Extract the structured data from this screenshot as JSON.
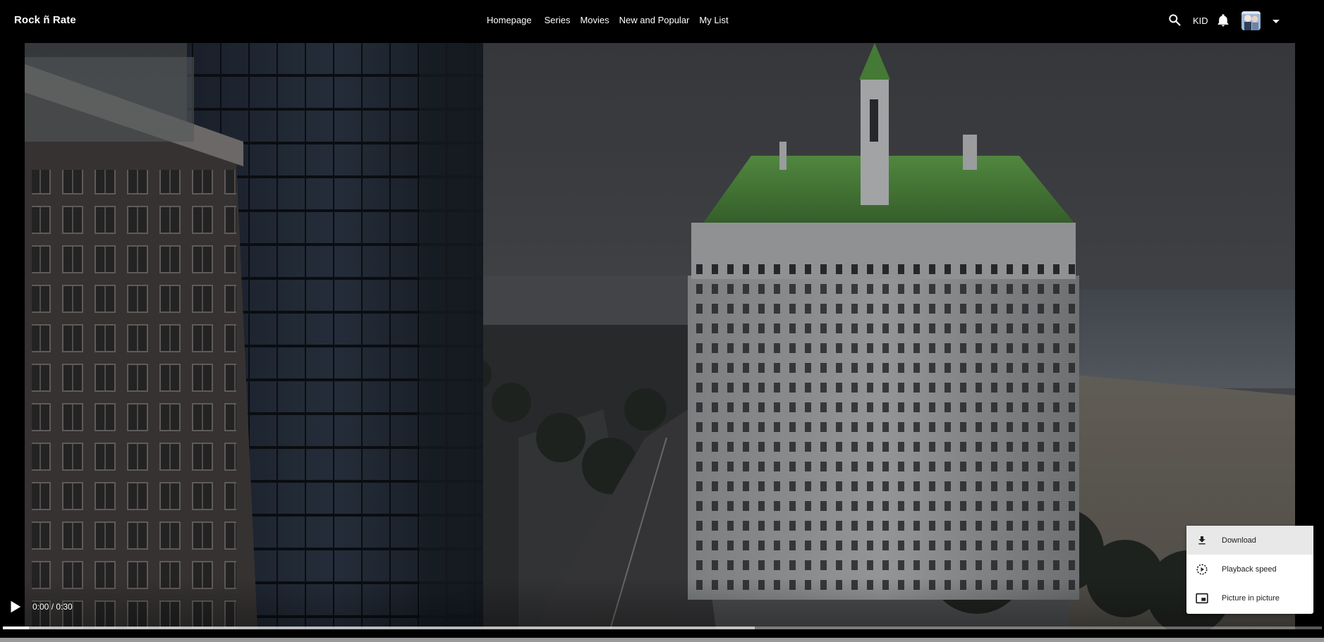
{
  "app": {
    "brand": "Rock ñ Rate"
  },
  "nav": {
    "items": [
      {
        "label": "Homepage"
      },
      {
        "label": "Series"
      },
      {
        "label": "Movies"
      },
      {
        "label": "New and Popular"
      },
      {
        "label": "My List"
      }
    ]
  },
  "header": {
    "search_icon": "search-icon",
    "profile_label": "KID",
    "notification_icon": "bell-icon",
    "dropdown_icon": "caret-down-icon"
  },
  "player": {
    "time_display": "0:00 / 0:30",
    "progress_played_fraction": 0.02,
    "progress_buffered_fraction": 0.57,
    "play_icon": "play-icon"
  },
  "options_menu": {
    "items": [
      {
        "label": "Download",
        "icon": "download-icon",
        "active": true
      },
      {
        "label": "Playback speed",
        "icon": "playback-speed-icon",
        "active": false
      },
      {
        "label": "Picture in picture",
        "icon": "picture-in-picture-icon",
        "active": false
      }
    ]
  },
  "colors": {
    "background": "#000000",
    "menu_background": "#ffffff",
    "menu_hover": "#e8e8e8",
    "roof_green": "#4f8a3e"
  }
}
